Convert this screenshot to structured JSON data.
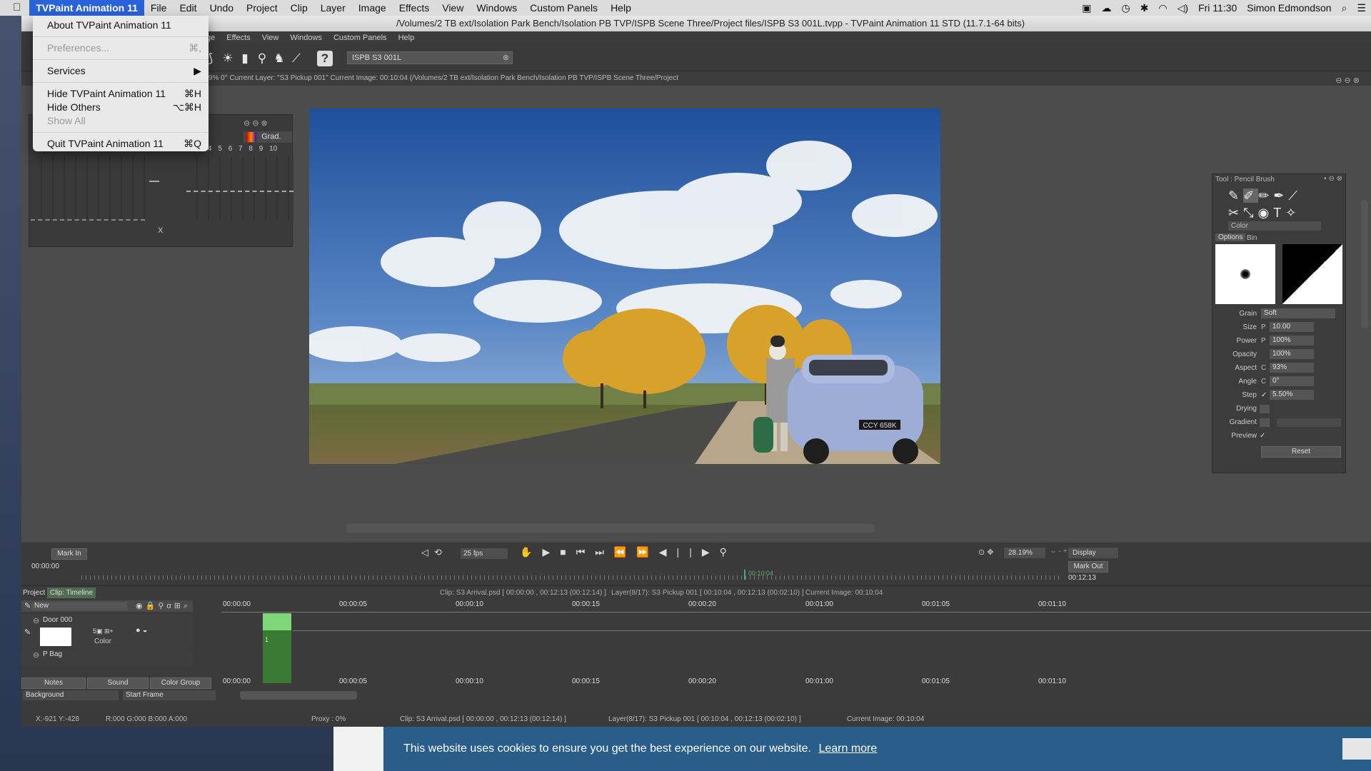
{
  "menubar": {
    "app_name": "TVPaint Animation 11",
    "items": [
      "File",
      "Edit",
      "Undo",
      "Project",
      "Clip",
      "Layer",
      "Image",
      "Effects",
      "View",
      "Windows",
      "Custom Panels",
      "Help"
    ],
    "clock": "Fri 11:30",
    "user": "Simon Edmondson"
  },
  "window": {
    "title": "/Volumes/2 TB ext/Isolation Park Bench/Isolation PB TVP/ISPB Scene Three/Project files/ISPB S3 001L.tvpp - TVPaint Animation 11 STD (11.7.1-64 bits)"
  },
  "app_menu": {
    "items": [
      "Effects",
      "View",
      "Windows",
      "Custom Panels",
      "Help"
    ],
    "partial": "ge"
  },
  "toolbar": {
    "project_name": "ISPB S3 001L"
  },
  "infobar": {
    "text": "8.19%   0°   Current Layer: \"S3 Pickup 001\"   Current Image: 00:10:04 (/Volumes/2 TB ext/Isolation Park Bench/Isolation PB TVP/ISPB Scene Three/Project"
  },
  "dropdown": {
    "about": "About TVPaint Animation 11",
    "preferences": "Preferences...",
    "preferences_sc": "⌘,",
    "services": "Services",
    "hide": "Hide TVPaint Animation 11",
    "hide_sc": "⌘H",
    "hide_others": "Hide Others",
    "hide_others_sc": "⌥⌘H",
    "show_all": "Show All",
    "quit": "Quit TVPaint Animation 11",
    "quit_sc": "⌘Q"
  },
  "left_panel": {
    "grad_label": "Grad.",
    "numbers": [
      "4",
      "5",
      "6",
      "7",
      "8",
      "9",
      "10"
    ],
    "x_label": "X"
  },
  "tool_panel": {
    "title": "Tool : Pencil Brush",
    "color_label": "Color",
    "tabs": [
      "Options",
      "Bin"
    ],
    "grain_label": "Grain",
    "grain_value": "Soft",
    "fields": [
      {
        "label": "Size",
        "mode": "P",
        "value": "10.00"
      },
      {
        "label": "Power",
        "mode": "P",
        "value": "100%"
      },
      {
        "label": "Opacity",
        "mode": "",
        "value": "100%"
      },
      {
        "label": "Aspect",
        "mode": "C",
        "value": "93%"
      },
      {
        "label": "Angle",
        "mode": "C",
        "value": "0°"
      },
      {
        "label": "Step",
        "mode": "✓",
        "value": "5.50%"
      }
    ],
    "drying_label": "Drying",
    "gradient_label": "Gradient",
    "preview_label": "Preview",
    "preview_check": "✓",
    "reset_label": "Reset"
  },
  "canvas": {
    "plate": "CCY 658K"
  },
  "transport": {
    "mark_in": "Mark In",
    "mark_out": "Mark Out",
    "fps": "25 fps",
    "zoom": "28.19%",
    "display": "Display",
    "start_time": "00:00:00",
    "end_time": "00:12:13",
    "cursor_time": "00:10:04"
  },
  "timeline": {
    "tabs": [
      "Project",
      "Clip: Timeline"
    ],
    "info_clip": "Clip: S3 Arrival.psd [ 00:00:00 , 00:12:13  (00:12:14) ]",
    "info_layer": "Layer(8/17): S3 Pickup 001 [ 00:10:04 , 00:12:13  (00:02:10) ]",
    "info_image": "Current Image: 00:10:04",
    "new_label": "New",
    "layers": [
      {
        "name": "Door 000",
        "sub": "Color"
      },
      {
        "name": "P Bag"
      }
    ],
    "ticks": [
      "00:00:00",
      "00:00:05",
      "00:00:10",
      "00:00:15",
      "00:00:20",
      "00:01:00",
      "00:01:05",
      "00:01:10"
    ],
    "bottom_tabs": [
      "Notes",
      "Sound",
      "Color Group"
    ],
    "background_label": "Background",
    "start_frame_label": "Start Frame",
    "frame_marker": "1"
  },
  "status": {
    "coords": "X:-921  Y:-428",
    "rgba": "R:000 G:000 B:000 A:000",
    "proxy": "Proxy : 0%",
    "clip": "Clip: S3 Arrival.psd [ 00:00:00 , 00:12:13  (00:12:14) ]",
    "layer": "Layer(8/17): S3 Pickup 001 [ 00:10:04 , 00:12:13  (00:02:10) ]",
    "image": "Current Image: 00:10:04"
  },
  "cookie": {
    "text": "This website uses cookies to ensure you get the best experience on our website.",
    "link": "Learn more"
  },
  "colors": {
    "menu_highlight": "#2a62d9",
    "panel_bg": "#3a3a3a",
    "timeline_green": "#3b7a33",
    "cookie_bg": "#2a5e8a"
  }
}
